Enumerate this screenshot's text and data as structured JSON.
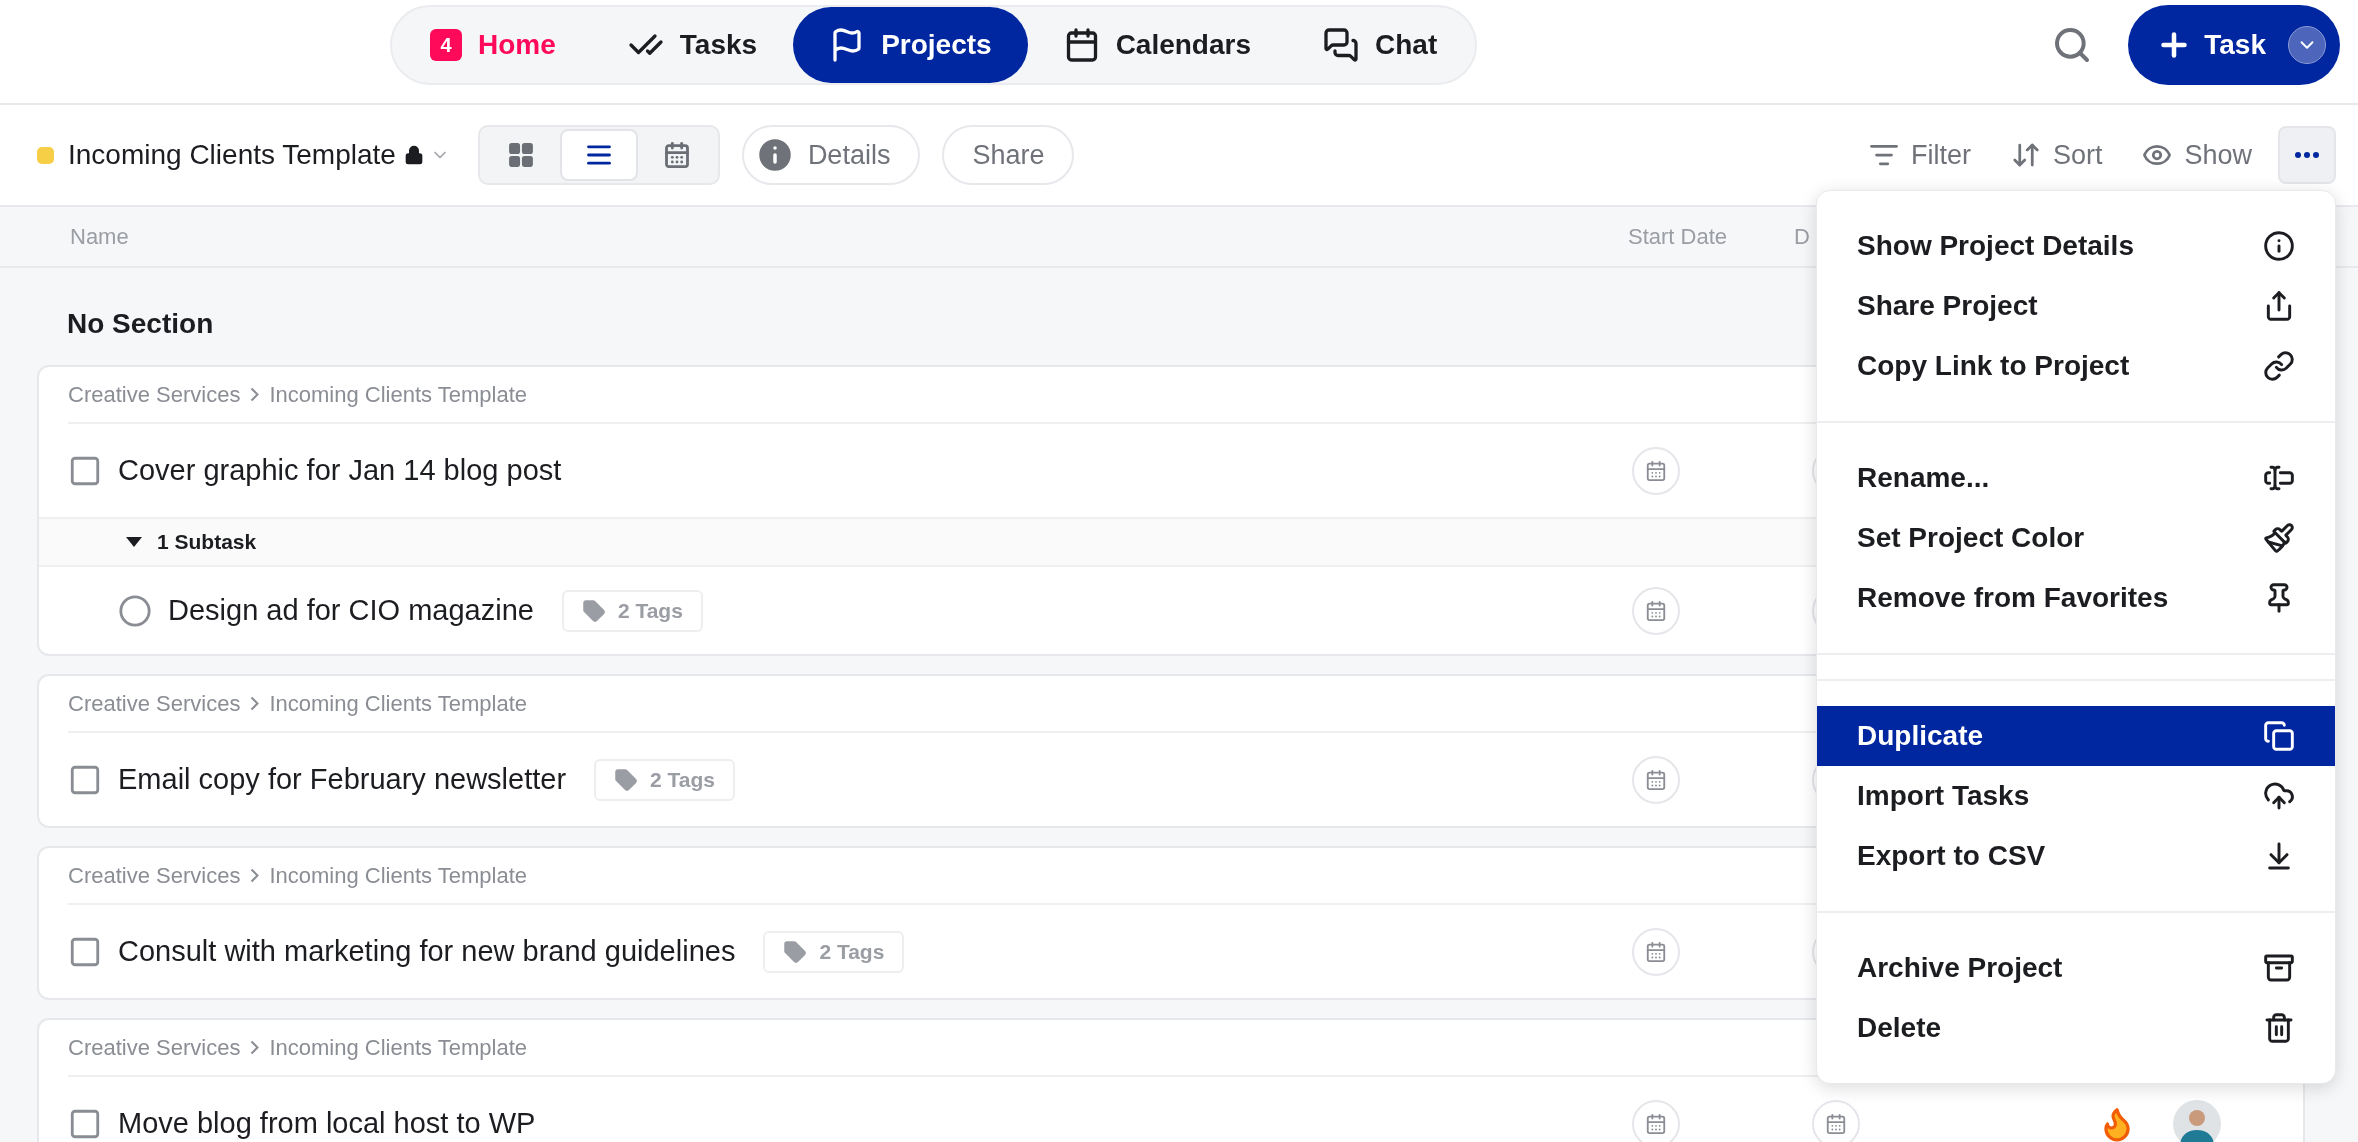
{
  "nav": {
    "tabs": [
      {
        "label": "Home",
        "badge": "4",
        "selected": false
      },
      {
        "label": "Tasks",
        "selected": false
      },
      {
        "label": "Projects",
        "selected": true
      },
      {
        "label": "Calendars",
        "selected": false
      },
      {
        "label": "Chat",
        "selected": false
      }
    ],
    "new_task_button": "Task"
  },
  "toolbar": {
    "project_title": "Incoming Clients Template",
    "views": [
      {
        "kind": "board",
        "selected": false
      },
      {
        "kind": "list",
        "selected": true
      },
      {
        "kind": "calendar",
        "selected": false
      }
    ],
    "details_button": "Details",
    "share_button": "Share",
    "actions": [
      "Filter",
      "Sort",
      "Show"
    ]
  },
  "table": {
    "columns": [
      "Name",
      "Start Date",
      "D"
    ],
    "section": "No Section",
    "cards": [
      {
        "breadcrumb": [
          "Creative Services",
          "Incoming Clients Template"
        ],
        "task": {
          "title": "Cover graphic for Jan 14 blog post",
          "done": false
        },
        "subtask_group": {
          "label": "1 Subtask",
          "expanded": true,
          "subtasks": [
            {
              "title": "Design ad for CIO magazine",
              "done": false,
              "tags": "2 Tags"
            }
          ]
        }
      },
      {
        "breadcrumb": [
          "Creative Services",
          "Incoming Clients Template"
        ],
        "task": {
          "title": "Email copy for February newsletter",
          "done": false,
          "tags": "2 Tags"
        }
      },
      {
        "breadcrumb": [
          "Creative Services",
          "Incoming Clients Template"
        ],
        "task": {
          "title": "Consult with marketing for new brand guidelines",
          "done": false,
          "tags": "2 Tags"
        }
      },
      {
        "breadcrumb": [
          "Creative Services",
          "Incoming Clients Template"
        ],
        "task": {
          "title": "Move blog from local host to WP",
          "done": false,
          "hot": true,
          "assigned": true
        }
      }
    ]
  },
  "menu": {
    "sections": [
      {
        "items": [
          {
            "label": "Show Project Details",
            "selected": false
          },
          {
            "label": "Share Project",
            "selected": false
          },
          {
            "label": "Copy Link to Project",
            "selected": false
          }
        ]
      },
      {
        "items": [
          {
            "label": "Rename...",
            "selected": false
          },
          {
            "label": "Set Project Color",
            "selected": false
          },
          {
            "label": "Remove from Favorites",
            "selected": false
          }
        ]
      },
      {
        "items": [
          {
            "label": "Duplicate",
            "selected": true
          },
          {
            "label": "Import Tasks",
            "selected": false
          },
          {
            "label": "Export to CSV",
            "selected": false
          }
        ]
      },
      {
        "items": [
          {
            "label": "Archive Project",
            "selected": false
          },
          {
            "label": "Delete",
            "selected": false
          }
        ]
      }
    ]
  }
}
